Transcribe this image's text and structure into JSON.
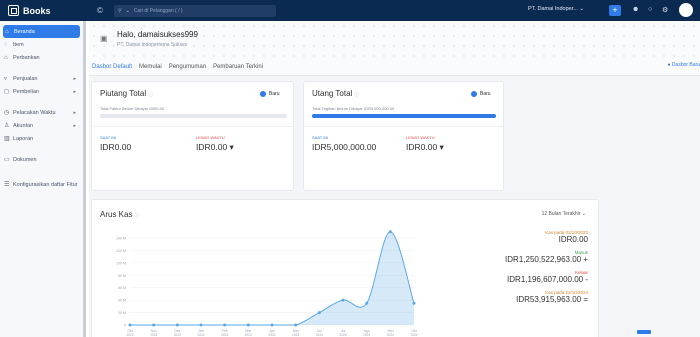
{
  "app": {
    "name": "Books"
  },
  "search": {
    "placeholder": "Cari di Pelanggan ( / )"
  },
  "topbar": {
    "company": "PT. Damai Indoper... ⌄",
    "plus": "+"
  },
  "sidebar": {
    "items": [
      {
        "label": "Beranda",
        "icon": "home-icon"
      },
      {
        "label": "Item",
        "icon": "item-icon"
      },
      {
        "label": "Perbankan",
        "icon": "bank-icon"
      },
      {
        "label": "Penjualan",
        "icon": "cart-icon"
      },
      {
        "label": "Pembelian",
        "icon": "bag-icon"
      },
      {
        "label": "Pelacakan Waktu",
        "icon": "clock-icon"
      },
      {
        "label": "Akuntan",
        "icon": "accountant-icon"
      },
      {
        "label": "Laporan",
        "icon": "report-icon"
      },
      {
        "label": "Dokumen",
        "icon": "folder-icon"
      },
      {
        "label": "Konfigurasikan daftar Fitur",
        "icon": "config-icon"
      }
    ]
  },
  "greeting": {
    "title": "Halo, damaisukses999",
    "subtitle": "PT. Damai Indopertama Sukses"
  },
  "tabs": [
    "Dasbor Default",
    "Memulai",
    "Pengumuman",
    "Pembaruan Terkini"
  ],
  "dashboard_badge": "Dasbor Baru",
  "receivables": {
    "title": "Piutang Total",
    "new_label": "Baru",
    "total_label": "Total Faktur Belum Dibayar IDR0.00",
    "progress": 0,
    "current_label": "SAAT INI",
    "current_value": "IDR0.00",
    "overdue_label": "LEWAT WAKTU",
    "overdue_value": "IDR0.00 ▾"
  },
  "payables": {
    "title": "Utang Total",
    "new_label": "Baru",
    "total_label": "Total Tagihan Belum Dibayar IDR5,000,000.00",
    "progress": 1,
    "current_label": "SAAT INI",
    "current_value": "IDR5,000,000.00",
    "overdue_label": "LEWAT WAKTU",
    "overdue_value": "IDR0.00 ▾"
  },
  "cashflow": {
    "title": "Arus Kas",
    "period": "12 Bulan Terakhir ⌄",
    "stats": [
      {
        "label": "Kas pada 01/10/2023",
        "value": "IDR0.00",
        "color": "#d9822b"
      },
      {
        "label": "Masuk",
        "value": "IDR1,250,522,963.00  +",
        "color": "#3aa757"
      },
      {
        "label": "Keluar",
        "value": "IDR1,196,607,000.00  -",
        "color": "#e04848"
      },
      {
        "label": "Kas pada 22/10/2024",
        "value": "IDR53,915,963.00  =",
        "color": "#d9822b"
      }
    ]
  },
  "chart_data": {
    "type": "area",
    "title": "Arus Kas",
    "xlabel": "",
    "ylabel": "",
    "categories": [
      "Okt 2023",
      "Nov 2023",
      "Des 2023",
      "Jan 2024",
      "Feb 2024",
      "Mar 2024",
      "Apr 2024",
      "Mei 2024",
      "Jun 2024",
      "Jul 2024",
      "Agu 2024",
      "Sep 2024",
      "Okt 2024"
    ],
    "yticks": [
      "0",
      "20 M",
      "40 M",
      "60 M",
      "80 M",
      "100 M",
      "120 M",
      "140 M"
    ],
    "ylim": [
      0,
      140
    ],
    "values": [
      0,
      0,
      0,
      0,
      0,
      0,
      0,
      0,
      20,
      40,
      35,
      150,
      35
    ],
    "color": "#5aa9e6",
    "grid": true
  }
}
